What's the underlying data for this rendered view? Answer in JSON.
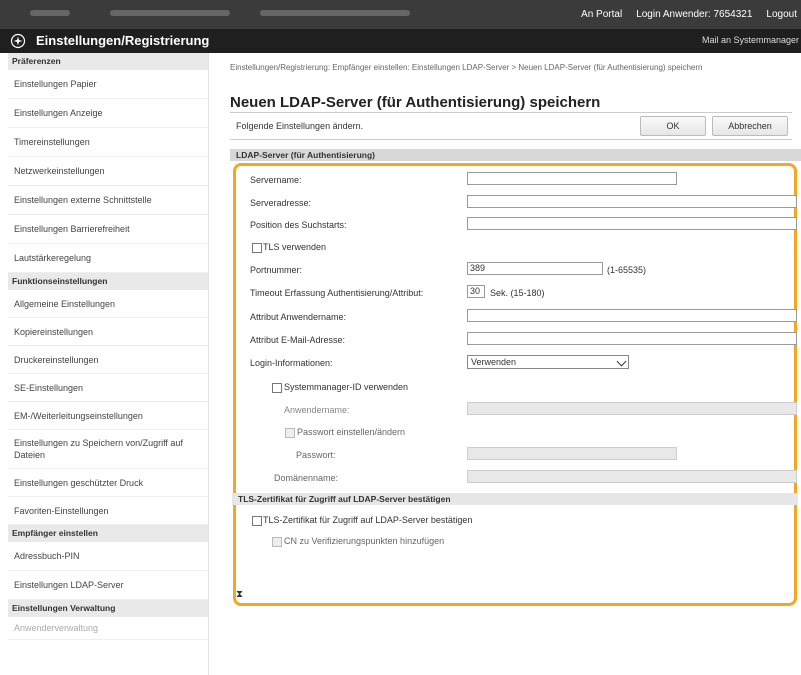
{
  "topbar": {
    "portal_link": "An Portal",
    "login_label": "Login Anwender: 7654321",
    "logout": "Logout"
  },
  "titlebar": {
    "title": "Einstellungen/Registrierung",
    "mail_link": "Mail an Systemmanager"
  },
  "sidebar": {
    "sections": [
      {
        "title": "Präferenzen",
        "items": [
          {
            "label": "Einstellungen Papier"
          },
          {
            "label": "Einstellungen Anzeige"
          },
          {
            "label": "Timereinstellungen"
          },
          {
            "label": "Netzwerkeinstellungen"
          },
          {
            "label": "Einstellungen externe Schnittstelle"
          },
          {
            "label": "Einstellungen Barrierefreiheit"
          },
          {
            "label": "Lautstärkeregelung"
          }
        ]
      },
      {
        "title": "Funktionseinstellungen",
        "items": [
          {
            "label": "Allgemeine Einstellungen"
          },
          {
            "label": "Kopiereinstellungen"
          },
          {
            "label": "Druckereinstellungen"
          },
          {
            "label": "SE-Einstellungen"
          },
          {
            "label": "EM-/Weiterleitungseinstellungen"
          },
          {
            "label": "Einstellungen zu Speichern von/Zugriff auf Dateien"
          },
          {
            "label": "Einstellungen geschützter Druck"
          },
          {
            "label": "Favoriten-Einstellungen"
          }
        ]
      },
      {
        "title": "Empfänger einstellen",
        "items": [
          {
            "label": "Adressbuch-PIN"
          },
          {
            "label": "Einstellungen LDAP-Server"
          }
        ]
      },
      {
        "title": "Einstellungen Verwaltung",
        "items": [
          {
            "label": "Anwenderverwaltung"
          }
        ]
      }
    ]
  },
  "main": {
    "breadcrumb": "Einstellungen/Registrierung: Empfänger einstellen: Einstellungen LDAP-Server > Neuen LDAP-Server (für Authentisierung) speichern",
    "page_title": "Neuen LDAP-Server (für Authentisierung) speichern",
    "hint": "Folgende Einstellungen ändern.",
    "ok_label": "OK",
    "cancel_label": "Abbrechen",
    "section_title": "LDAP-Server (für Authentisierung)",
    "fields": {
      "server_name": {
        "label": "Servername:",
        "value": ""
      },
      "server_address": {
        "label": "Serveradresse:",
        "value": ""
      },
      "search_start": {
        "label": "Position des Suchstarts:",
        "value": ""
      },
      "use_tls": {
        "label": "TLS verwenden"
      },
      "port": {
        "label": "Portnummer:",
        "value": "389",
        "range": "(1-65535)"
      },
      "timeout": {
        "label": "Timeout Erfassung Authentisierung/Attribut:",
        "value": "30",
        "range": "Sek. (15-180)"
      },
      "attr_username": {
        "label": "Attribut Anwendername:",
        "value": ""
      },
      "attr_email": {
        "label": "Attribut E-Mail-Adresse:",
        "value": ""
      },
      "login_info": {
        "label": "Login-Informationen:",
        "value": "Verwenden"
      },
      "use_sysmgr": {
        "label": "Systemmanager-ID verwenden"
      },
      "username": {
        "label": "Anwendername:"
      },
      "set_password": {
        "label": "Passwort einstellen/ändern"
      },
      "password": {
        "label": "Passwort:"
      },
      "domain": {
        "label": "Domänenname:"
      }
    },
    "tls_section_title": "TLS-Zertifikat für Zugriff auf LDAP-Server bestätigen",
    "tls_confirm": "TLS-Zertifikat für Zugriff auf LDAP-Server bestätigen",
    "cn_add": "CN zu Verifizierungspunkten hinzufügen",
    "to_top": "⧗"
  }
}
